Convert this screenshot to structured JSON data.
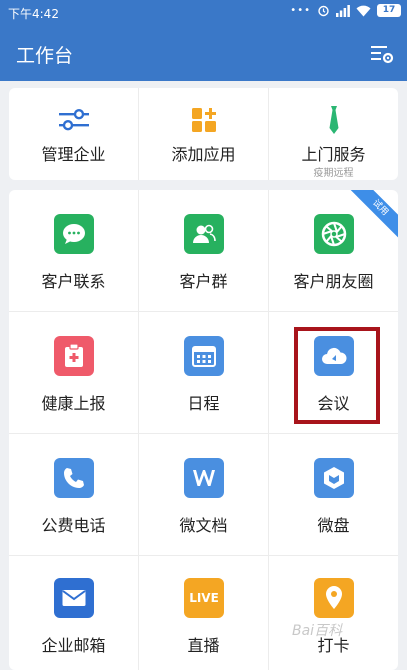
{
  "status": {
    "time": "下午4:42",
    "dots": "•••",
    "battery": "17"
  },
  "appbar": {
    "title": "工作台"
  },
  "section1": [
    {
      "label": "管理企业",
      "icon": "sliders-icon",
      "color": "#2f6fd1",
      "sub": ""
    },
    {
      "label": "添加应用",
      "icon": "add-app-icon",
      "color": "#f4a623",
      "sub": ""
    },
    {
      "label": "上门服务",
      "icon": "tie-icon",
      "color": "#2bb673",
      "sub": "疫期远程"
    }
  ],
  "trial_badge": "试用",
  "section2": [
    {
      "label": "客户联系",
      "icon": "chat-bubble-icon",
      "color": "#27b15f"
    },
    {
      "label": "客户群",
      "icon": "group-icon",
      "color": "#27b15f"
    },
    {
      "label": "客户朋友圈",
      "icon": "aperture-icon",
      "color": "#27b15f"
    },
    {
      "label": "健康上报",
      "icon": "medical-clipboard-icon",
      "color": "#ef5a6a"
    },
    {
      "label": "日程",
      "icon": "calendar-icon",
      "color": "#4a8fe0"
    },
    {
      "label": "会议",
      "icon": "cloud-icon",
      "color": "#4a8fe0"
    },
    {
      "label": "公费电话",
      "icon": "phone-icon",
      "color": "#4a8fe0"
    },
    {
      "label": "微文档",
      "icon": "w-doc-icon",
      "color": "#4a8fe0"
    },
    {
      "label": "微盘",
      "icon": "cube-drive-icon",
      "color": "#4a8fe0"
    },
    {
      "label": "企业邮箱",
      "icon": "mail-icon",
      "color": "#2f6fd1"
    },
    {
      "label": "直播",
      "icon": "live-icon",
      "color": "#f4a623"
    },
    {
      "label": "打卡",
      "icon": "location-pin-icon",
      "color": "#f4a623"
    }
  ],
  "watermark": "Bai百科"
}
